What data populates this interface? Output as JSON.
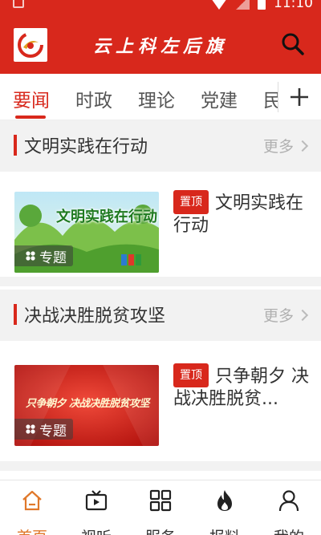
{
  "status_bar": {
    "time": "11:10"
  },
  "app": {
    "title": "云上科左后旗"
  },
  "tabs": [
    "要闻",
    "时政",
    "理论",
    "党建",
    "民"
  ],
  "sections": [
    {
      "title": "文明实践在行动",
      "more": "更多",
      "card": {
        "pin": "置顶",
        "title": "文明实践在行动",
        "thumb_text": "文明实践在行动",
        "badge": "专题"
      }
    },
    {
      "title": "决战决胜脱贫攻坚",
      "more": "更多",
      "card": {
        "pin": "置顶",
        "title": "只争朝夕 决战决胜脱贫...",
        "thumb_text": "只争朝夕 决战决胜脱贫攻坚",
        "badge": "专题"
      }
    }
  ],
  "bottom_nav": [
    {
      "label": "首页",
      "icon": "home-icon"
    },
    {
      "label": "视听",
      "icon": "tv-icon"
    },
    {
      "label": "服务",
      "icon": "grid-icon"
    },
    {
      "label": "报料",
      "icon": "flame-icon"
    },
    {
      "label": "我的",
      "icon": "user-icon"
    }
  ],
  "colors": {
    "brand": "#d8281c",
    "nav_active": "#e0782a"
  }
}
